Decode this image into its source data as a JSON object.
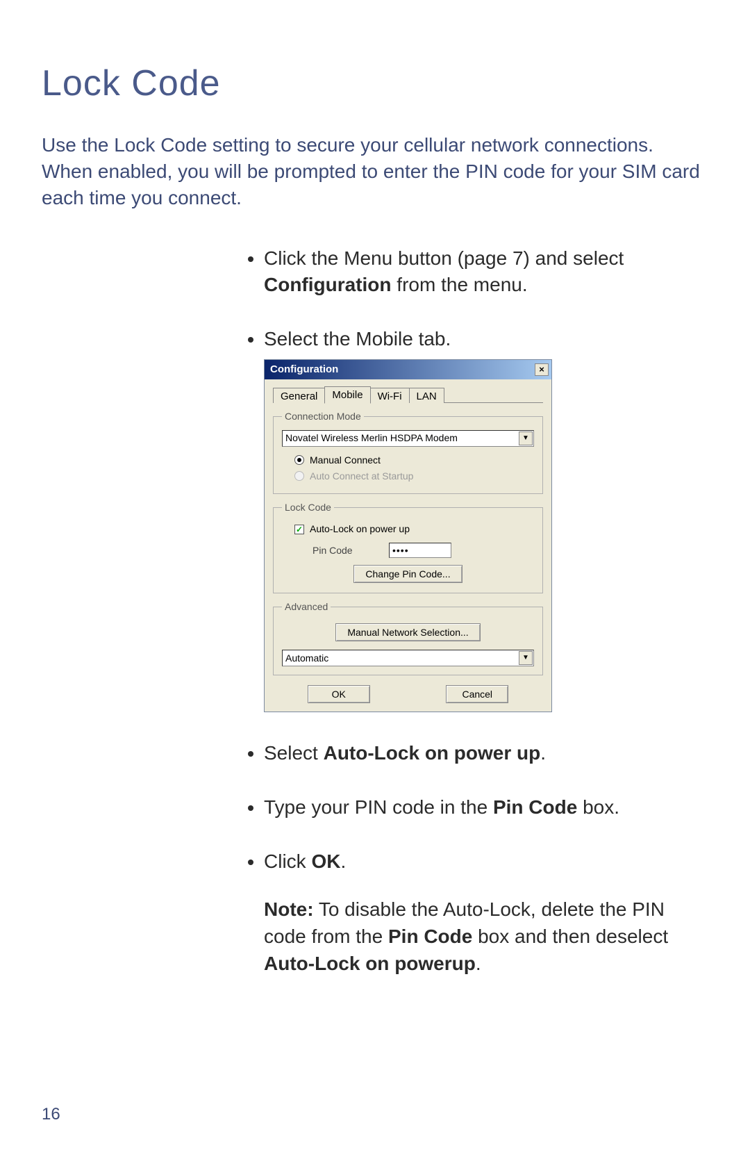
{
  "page": {
    "title": "Lock Code",
    "intro": "Use the Lock Code setting to secure your cellular network connections. When enabled, you will be prompted to enter the PIN code for your SIM card each time you connect.",
    "number": "16"
  },
  "steps": {
    "s1a": "Click the Menu button (page 7) and select ",
    "s1b": "Configuration",
    "s1c": " from the menu.",
    "s2": "Select the Mobile tab.",
    "s3a": "Select ",
    "s3b": "Auto-Lock on power up",
    "s3c": ".",
    "s4a": "Type your PIN code in the ",
    "s4b": "Pin Code",
    "s4c": " box.",
    "s5a": "Click ",
    "s5b": "OK",
    "s5c": "."
  },
  "note": {
    "lead": "Note:",
    "t1": " To disable the Auto-Lock, delete the PIN code from the ",
    "t2": "Pin Code",
    "t3": " box and then deselect ",
    "t4": "Auto-Lock on powerup",
    "t5": "."
  },
  "dialog": {
    "title": "Configuration",
    "close": "×",
    "tabs": {
      "general": "General",
      "mobile": "Mobile",
      "wifi": "Wi-Fi",
      "lan": "LAN"
    },
    "groups": {
      "connection": {
        "legend": "Connection Mode",
        "modem": "Novatel Wireless Merlin HSDPA Modem",
        "manual": "Manual Connect",
        "auto": "Auto Connect at Startup"
      },
      "lock": {
        "legend": "Lock Code",
        "autolock": "Auto-Lock on power up",
        "pinlabel": "Pin Code",
        "pinvalue": "••••",
        "changebtn": "Change Pin Code..."
      },
      "advanced": {
        "legend": "Advanced",
        "mns": "Manual Network Selection...",
        "autosel": "Automatic"
      }
    },
    "buttons": {
      "ok": "OK",
      "cancel": "Cancel"
    }
  }
}
